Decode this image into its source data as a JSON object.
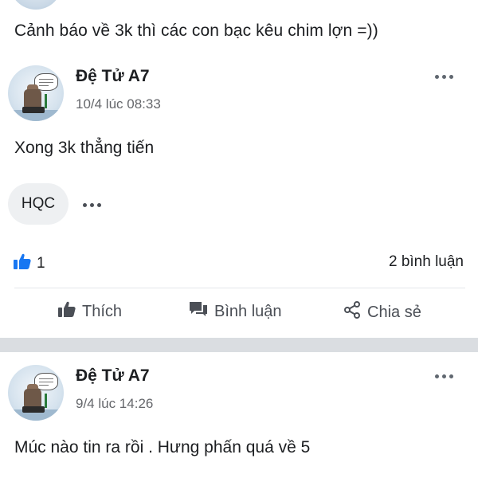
{
  "previous_post": {
    "text": "Cảnh báo về 3k thì các con bạc kêu chim lợn =))"
  },
  "posts": [
    {
      "author": "Đệ Tử A7",
      "timestamp": "10/4 lúc 08:33",
      "content": "Xong 3k thẳng tiến",
      "comment_preview": "HQC",
      "like_count": "1",
      "comment_count": "2 bình luận"
    },
    {
      "author": "Đệ Tử A7",
      "timestamp": "9/4 lúc 14:26",
      "content": "Múc nào tin ra rồi . Hưng phấn quá về 5"
    }
  ],
  "actions": {
    "like": "Thích",
    "comment": "Bình luận",
    "share": "Chia sẻ"
  },
  "colors": {
    "like_blue": "#1877f2",
    "action_grey": "#4b4f56",
    "timestamp_grey": "#65676b",
    "separator": "#dadde1"
  },
  "icons": [
    "more-icon",
    "thumb-up-icon",
    "comment-icon",
    "share-icon"
  ]
}
